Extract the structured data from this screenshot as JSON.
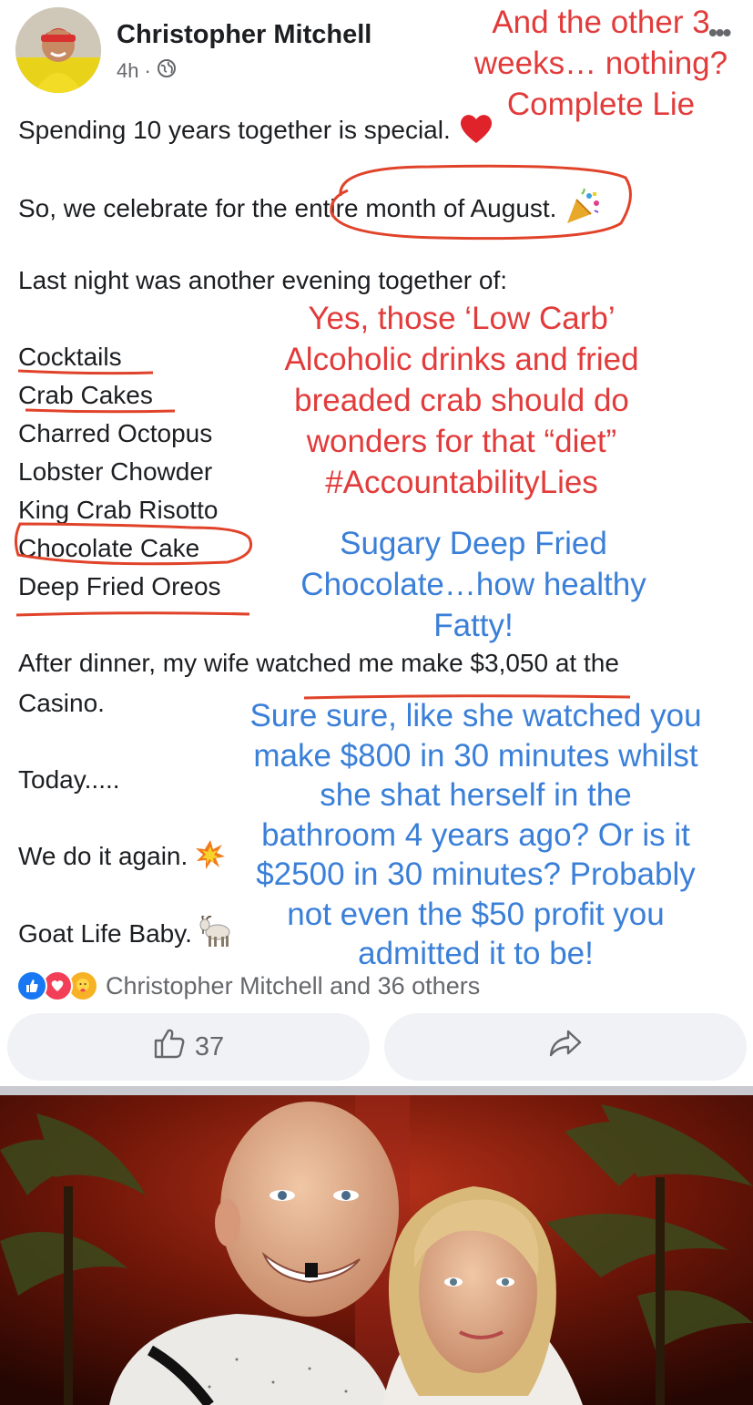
{
  "post": {
    "author": "Christopher Mitchell",
    "time": "4h",
    "dot": "·",
    "more": "•••",
    "lines": {
      "line1": "Spending 10 years together is special.",
      "line2": "So, we celebrate for the entire month of August.",
      "line3": "Last night was another evening together of:",
      "after1": "After dinner, my wife watched me make $3,050 at the",
      "after2": "Casino.",
      "today": "Today.....",
      "again": "We do it again.",
      "goat": "Goat Life Baby."
    },
    "menu_items": [
      "Cocktails",
      "Crab Cakes",
      "Charred Octopus",
      "Lobster Chowder",
      "King Crab Risotto",
      "Chocolate Cake",
      "Deep Fried Oreos"
    ]
  },
  "annotations": {
    "red_top": [
      "And the other 3",
      "weeks… nothing?",
      "Complete Lie"
    ],
    "red_middle": [
      "Yes, those ‘Low Carb’",
      "Alcoholic drinks and fried",
      "breaded crab should do",
      "wonders for that “diet”",
      "#AccountabilityLies"
    ],
    "blue_middle": [
      "Sugary Deep Fried",
      "Chocolate…how healthy",
      "Fatty!"
    ],
    "blue_bottom": [
      "Sure sure, like she watched you",
      "make $800 in 30 minutes whilst",
      "she shat herself in the",
      "bathroom 4 years ago? Or is it",
      "$2500 in 30 minutes? Probably",
      "not even the $50 profit you",
      "admitted it to be!"
    ]
  },
  "reactions": {
    "summary": "Christopher Mitchell and 36 others",
    "types": [
      "like-icon",
      "love-icon",
      "care-icon"
    ],
    "colors": {
      "like": "#1877f2",
      "love": "#f33e58",
      "care": "#f7b125"
    }
  },
  "actions": {
    "like_count": "37",
    "share_icon": "share-icon"
  },
  "colors": {
    "annotation_red": "#e23b3b",
    "annotation_blue": "#3a7fd8",
    "text_secondary": "#65676b"
  }
}
